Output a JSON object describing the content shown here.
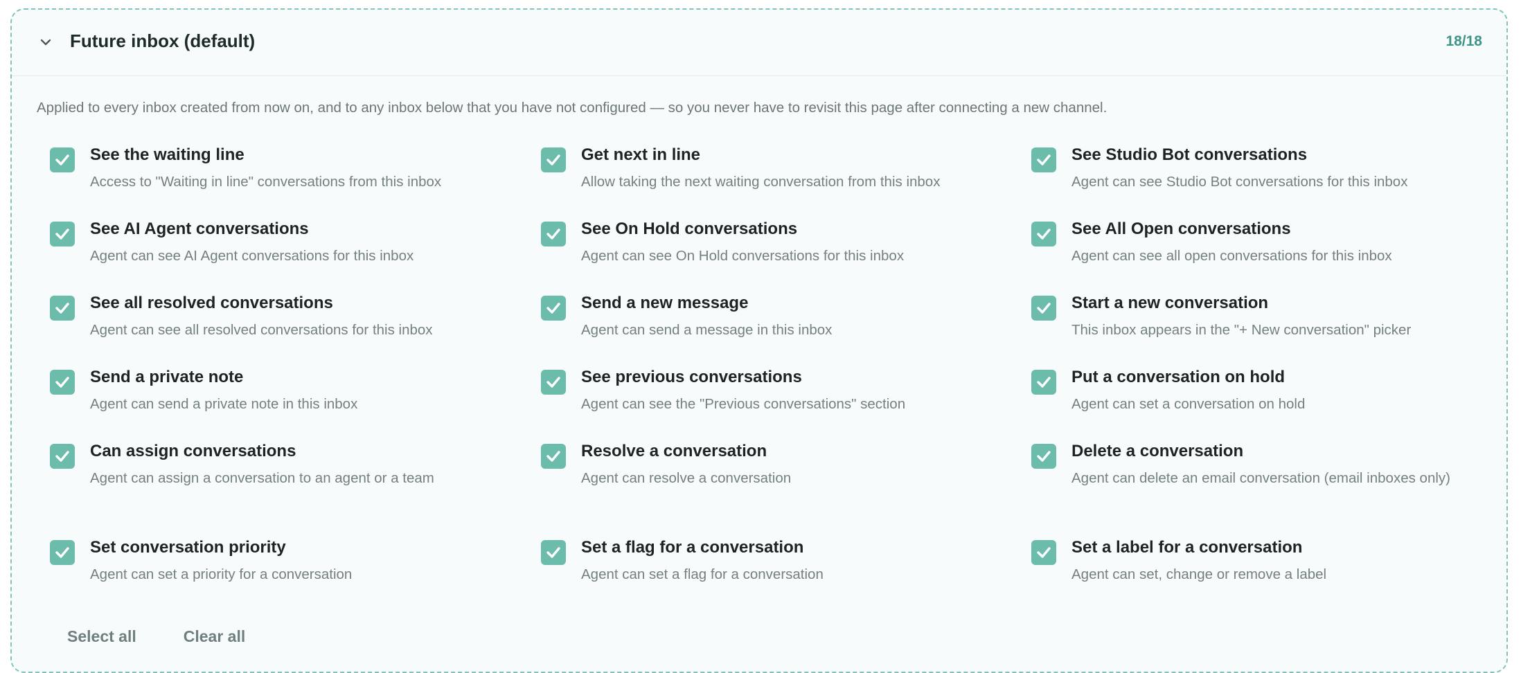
{
  "section": {
    "title": "Future inbox (default)",
    "count": "18/18",
    "description": "Applied to every inbox created from now on, and to any inbox below that you have not configured — so you never have to revisit this page after connecting a new channel."
  },
  "colors": {
    "accent": "#6cbcac",
    "count_text": "#3d9487",
    "border": "#7fc4b6"
  },
  "permissions": [
    {
      "label": "See the waiting line",
      "desc": "Access to \"Waiting in line\" conversations from this inbox",
      "checked": true
    },
    {
      "label": "Get next in line",
      "desc": "Allow taking the next waiting conversation from this inbox",
      "checked": true
    },
    {
      "label": "See Studio Bot conversations",
      "desc": "Agent can see Studio Bot conversations for this inbox",
      "checked": true
    },
    {
      "label": "See AI Agent conversations",
      "desc": "Agent can see AI Agent conversations for this inbox",
      "checked": true
    },
    {
      "label": "See On Hold conversations",
      "desc": "Agent can see On Hold conversations for this inbox",
      "checked": true
    },
    {
      "label": "See All Open conversations",
      "desc": "Agent can see all open conversations for this inbox",
      "checked": true
    },
    {
      "label": "See all resolved conversations",
      "desc": "Agent can see all resolved conversations for this inbox",
      "checked": true
    },
    {
      "label": "Send a new message",
      "desc": "Agent can send a message in this inbox",
      "checked": true
    },
    {
      "label": "Start a new conversation",
      "desc": "This inbox appears in the \"+ New conversation\" picker",
      "checked": true
    },
    {
      "label": "Send a private note",
      "desc": "Agent can send a private note in this inbox",
      "checked": true
    },
    {
      "label": "See previous conversations",
      "desc": "Agent can see the \"Previous conversations\" section",
      "checked": true
    },
    {
      "label": "Put a conversation on hold",
      "desc": "Agent can set a conversation on hold",
      "checked": true
    },
    {
      "label": "Can assign conversations",
      "desc": "Agent can assign a conversation to an agent or a team",
      "checked": true
    },
    {
      "label": "Resolve a conversation",
      "desc": "Agent can resolve a conversation",
      "checked": true
    },
    {
      "label": "Delete a conversation",
      "desc": "Agent can delete an email conversation (email inboxes only)",
      "checked": true
    },
    {
      "label": "Set conversation priority",
      "desc": "Agent can set a priority for a conversation",
      "checked": true
    },
    {
      "label": "Set a flag for a conversation",
      "desc": "Agent can set a flag for a conversation",
      "checked": true
    },
    {
      "label": "Set a label for a conversation",
      "desc": "Agent can set, change or remove a label",
      "checked": true
    }
  ],
  "actions": {
    "select_all": "Select all",
    "clear_all": "Clear all"
  }
}
